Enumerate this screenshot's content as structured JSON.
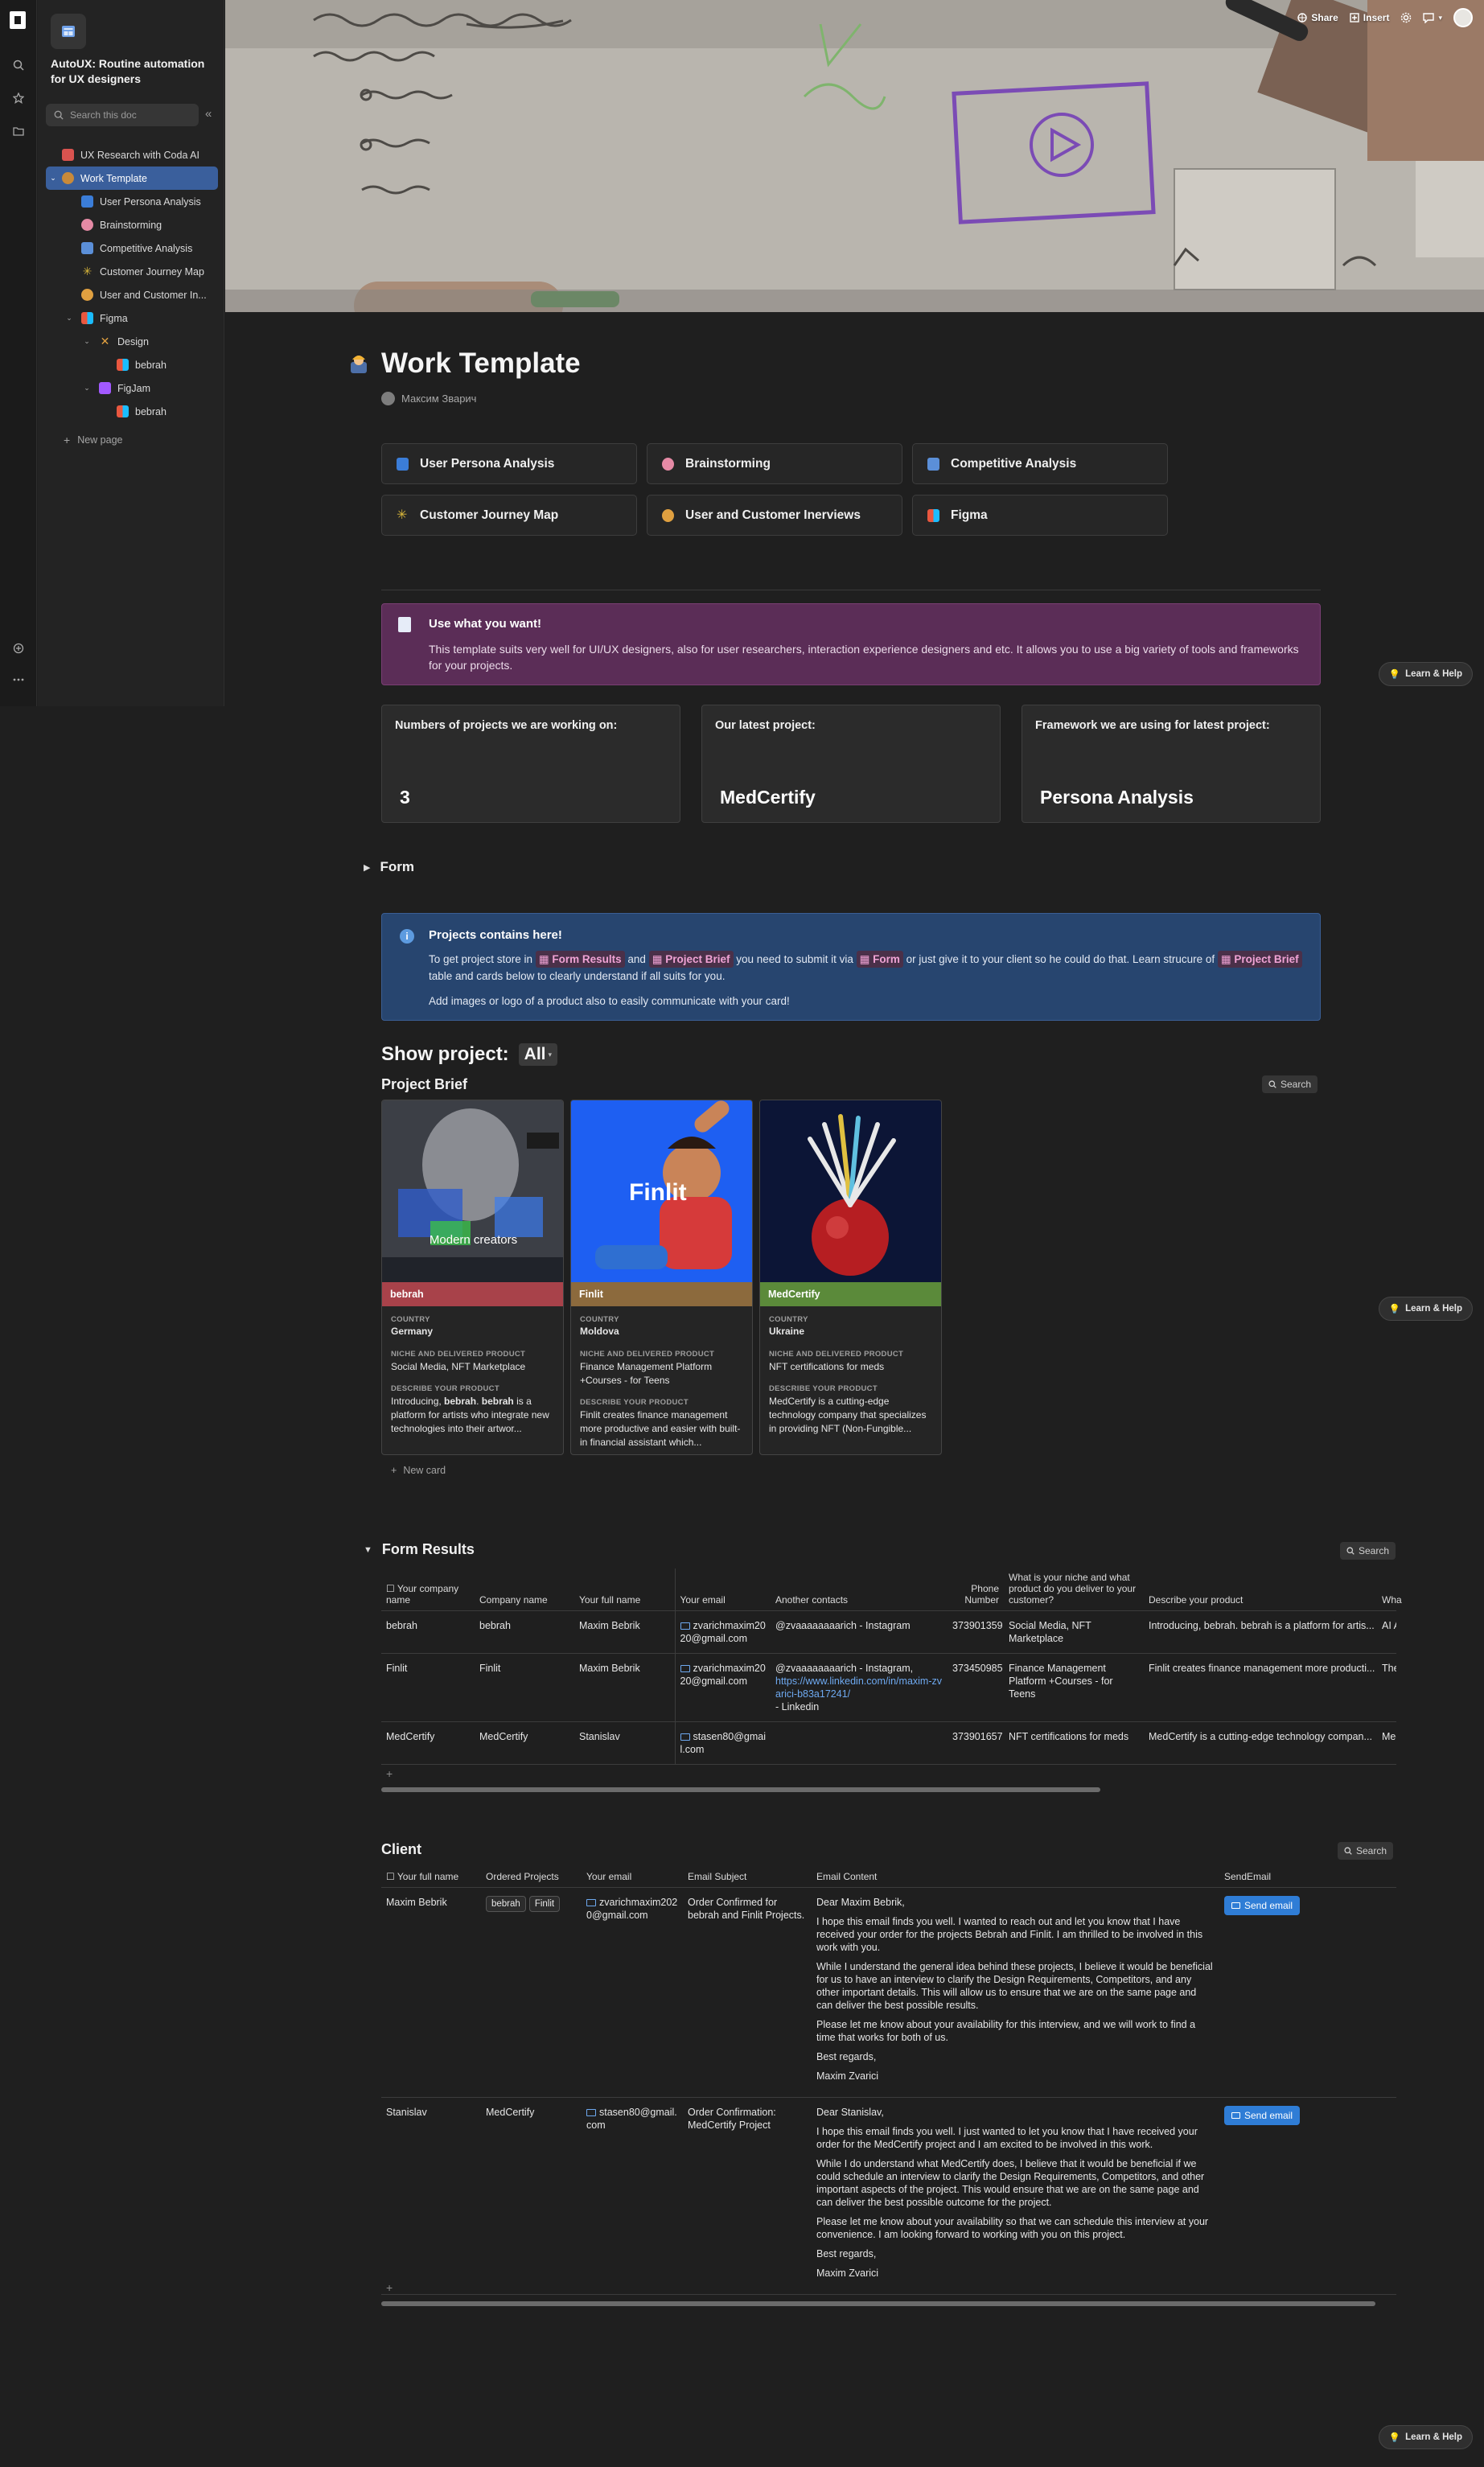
{
  "doc": {
    "title": "AutoUX: Routine automation for UX designers",
    "search_placeholder": "Search this doc"
  },
  "topbar": {
    "share": "Share",
    "insert": "Insert"
  },
  "sidebar": {
    "items": [
      {
        "label": "UX Research with Coda AI",
        "icon": "doc-icon",
        "color": "#d9534f"
      },
      {
        "label": "Work Template",
        "icon": "worker-emoji",
        "color": "#c98a3a"
      },
      {
        "label": "User Persona Analysis",
        "icon": "persona-icon",
        "color": "#3b7dd8"
      },
      {
        "label": "Brainstorming",
        "icon": "brain-icon",
        "color": "#e58aa5"
      },
      {
        "label": "Competitive Analysis",
        "icon": "doc-page-icon",
        "color": "#5b8fd8"
      },
      {
        "label": "Customer Journey Map",
        "icon": "sparkle-icon",
        "color": "#d8b63b"
      },
      {
        "label": "User and Customer In...",
        "icon": "person-icon",
        "color": "#e0a040"
      },
      {
        "label": "Figma",
        "icon": "figma-icon",
        "color": "#e9573f"
      },
      {
        "label": "Design",
        "icon": "tools-icon",
        "color": "#e0a040"
      },
      {
        "label": "bebrah",
        "icon": "figma-icon",
        "color": "#e9573f"
      },
      {
        "label": "FigJam",
        "icon": "figjam-icon",
        "color": "#a259ff"
      },
      {
        "label": "bebrah",
        "icon": "figma-icon",
        "color": "#e9573f"
      }
    ],
    "new_page": "New page"
  },
  "page": {
    "title": "Work Template",
    "author": "Максим Зварич"
  },
  "links": [
    {
      "label": "User Persona Analysis",
      "color": "#3b7dd8"
    },
    {
      "label": "Brainstorming",
      "color": "#e58aa5"
    },
    {
      "label": "Competitive Analysis",
      "color": "#5b8fd8"
    },
    {
      "label": "Customer Journey Map",
      "color": "#d8b63b"
    },
    {
      "label": "User and Customer Inerviews",
      "color": "#e0a040"
    },
    {
      "label": "Figma",
      "color": "#e9573f"
    }
  ],
  "callout1": {
    "title": "Use what you want!",
    "body": "This template suits very well for UI/UX designers, also for user researchers, interaction experience designers and etc. It allows you to use a big variety of tools and frameworks for your projects."
  },
  "stats": [
    {
      "label": "Numbers of projects we are working on:",
      "value": "3"
    },
    {
      "label": "Our latest project:",
      "value": "MedCertify"
    },
    {
      "label": "Framework we are using for latest project:",
      "value": "Persona Analysis"
    }
  ],
  "form_section": "Form",
  "callout2": {
    "title": "Projects contains here!",
    "l1a": "To get project store in",
    "chip_results": "Form Results",
    "l1b": "and",
    "chip_brief": "Project Brief",
    "l1c": "you need to submit it via",
    "chip_form": "Form",
    "l1d": "or just give it to your client so he could do that. Learn strucure of",
    "chip_brief2": "Project Brief",
    "l1e": "table and cards below to clearly understand if all suits for you.",
    "line2": "Add images or logo of a product also to easily communicate with your card!"
  },
  "show_project": {
    "label": "Show project:",
    "filter": "All"
  },
  "brief": {
    "title": "Project Brief",
    "search": "Search",
    "field_country": "COUNTRY",
    "field_niche": "NICHE AND DELIVERED PRODUCT",
    "field_describe": "DESCRIBE YOUR PRODUCT",
    "new_card": "New card",
    "cards": [
      {
        "name": "bebrah",
        "band": "#a8424a",
        "country": "Germany",
        "niche": "Social Media, NFT Marketplace",
        "d1": "Introducing, ",
        "d2": "bebrah",
        "d3": ". ",
        "d4": "bebrah",
        "d5": " is a platform for artists who integrate new technologies into their artwor...",
        "img_caption": "Modern creators"
      },
      {
        "name": "Finlit",
        "band": "#8c6a3d",
        "country": "Moldova",
        "niche": "Finance Management Platform +Courses - for Teens",
        "desc": "Finlit creates finance management more productive and easier with built-in financial assistant which...",
        "img_caption": "Finlit"
      },
      {
        "name": "MedCertify",
        "band": "#5b8a3a",
        "country": "Ukraine",
        "niche": "NFT certifications for meds",
        "desc": "MedCertify is a cutting-edge technology company that specializes in providing NFT (Non-Fungible..."
      }
    ]
  },
  "results": {
    "title": "Form Results",
    "search": "Search",
    "headers": [
      "Your company name",
      "Company name",
      "Your full name",
      "Your email",
      "Another contacts",
      "Phone Number",
      "What is your niche and what product do you deliver to your customer?",
      "Describe your product",
      "Wha"
    ],
    "rows": [
      {
        "c1": "bebrah",
        "c2": "bebrah",
        "c3": "Maxim Bebrik",
        "email": "zvarichmaxim2020@gmail.com",
        "contacts": "@zvaaaaaaaarich - Instagram",
        "link": "",
        "contacts2": "",
        "phone": "373901359",
        "niche": "Social Media, NFT Marketplace",
        "desc": "Introducing, bebrah. bebrah is a platform for artis...",
        "wha": "AI A"
      },
      {
        "c1": "Finlit",
        "c2": "Finlit",
        "c3": "Maxim Bebrik",
        "email": "zvarichmaxim2020@gmail.com",
        "contacts": "@zvaaaaaaaarich - Instagram,",
        "link": "https://www.linkedin.com/in/maxim-zvarici-b83a17241/",
        "contacts2": "- Linkedin",
        "phone": "373450985",
        "niche": "Finance Management Platform +Courses - for Teens",
        "desc": "Finlit creates finance management more producti...",
        "wha": "The"
      },
      {
        "c1": "MedCertify",
        "c2": "MedCertify",
        "c3": "Stanislav",
        "email": "stasen80@gmail.com",
        "contacts": "",
        "link": "",
        "contacts2": "",
        "phone": "373901657",
        "niche": "NFT certifications for meds",
        "desc": "MedCertify is a cutting-edge technology compan...",
        "wha": "Med"
      }
    ]
  },
  "client": {
    "title": "Client",
    "search": "Search",
    "headers": [
      "Your full name",
      "Ordered Projects",
      "Your email",
      "Email Subject",
      "Email Content",
      "SendEmail"
    ],
    "send": "Send email",
    "rows": [
      {
        "name": "Maxim Bebrik",
        "p1": "bebrah",
        "p2": "Finlit",
        "email": "zvarichmaxim2020@gmail.com",
        "subject": "Order Confirmed for bebrah and Finlit Projects.",
        "e1": "Dear Maxim Bebrik,",
        "e2": "I hope this email finds you well. I wanted to reach out and let you know that I have received your order for the projects Bebrah and Finlit. I am thrilled to be involved in this work with you.",
        "e3": "While I understand the general idea behind these projects, I believe it would be beneficial for us to have an interview to clarify the Design Requirements, Competitors, and any other important details. This will allow us to ensure that we are on the same page and can deliver the best possible results.",
        "e4": "Please let me know about your availability for this interview, and we will work to find a time that works for both of us.",
        "e5": "Best regards,",
        "e6": "Maxim Zvarici"
      },
      {
        "name": "Stanislav",
        "p1": "MedCertify",
        "p2": "",
        "email": "stasen80@gmail.com",
        "subject": "Order Confirmation: MedCertify Project",
        "e1": "Dear Stanislav,",
        "e2": "I hope this email finds you well. I just wanted to let you know that I have received your order for the MedCertify project and I am excited to be involved in this work.",
        "e3": "While I do understand what MedCertify does, I believe that it would be beneficial if we could schedule an interview to clarify the Design Requirements, Competitors, and other important aspects of the project. This would ensure that we are on the same page and can deliver the best possible outcome for the project.",
        "e4": "Please let me know about your availability so that we can schedule this interview at your convenience. I am looking forward to working with you on this project.",
        "e5": "Best regards,",
        "e6": "Maxim Zvarici"
      }
    ]
  },
  "help": "Learn & Help",
  "add_row": "+"
}
